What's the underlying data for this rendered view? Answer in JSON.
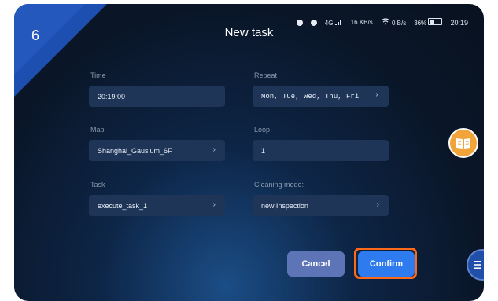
{
  "step_number": "6",
  "title": "New task",
  "status_bar": {
    "network_type": "4G",
    "speed_1": "16",
    "speed_1_unit": "KB/s",
    "speed_2": "0",
    "speed_2_unit": "B/s",
    "battery": "36%",
    "time": "20:19"
  },
  "form": {
    "time": {
      "label": "Time",
      "value": "20:19:00"
    },
    "repeat": {
      "label": "Repeat",
      "value": "Mon, Tue, Wed, Thu, Fri"
    },
    "map": {
      "label": "Map",
      "value": "Shanghai_Gausium_6F"
    },
    "loop": {
      "label": "Loop",
      "value": "1"
    },
    "task": {
      "label": "Task",
      "value": "execute_task_1"
    },
    "cleaning_mode": {
      "label": "Cleaning mode:",
      "value": "new|Inspection"
    }
  },
  "buttons": {
    "cancel": "Cancel",
    "confirm": "Confirm"
  },
  "colors": {
    "accent": "#2e7bf0",
    "highlight": "#ff6a1a",
    "book_button": "#f2a43b",
    "field_bg": "#1f3558"
  }
}
